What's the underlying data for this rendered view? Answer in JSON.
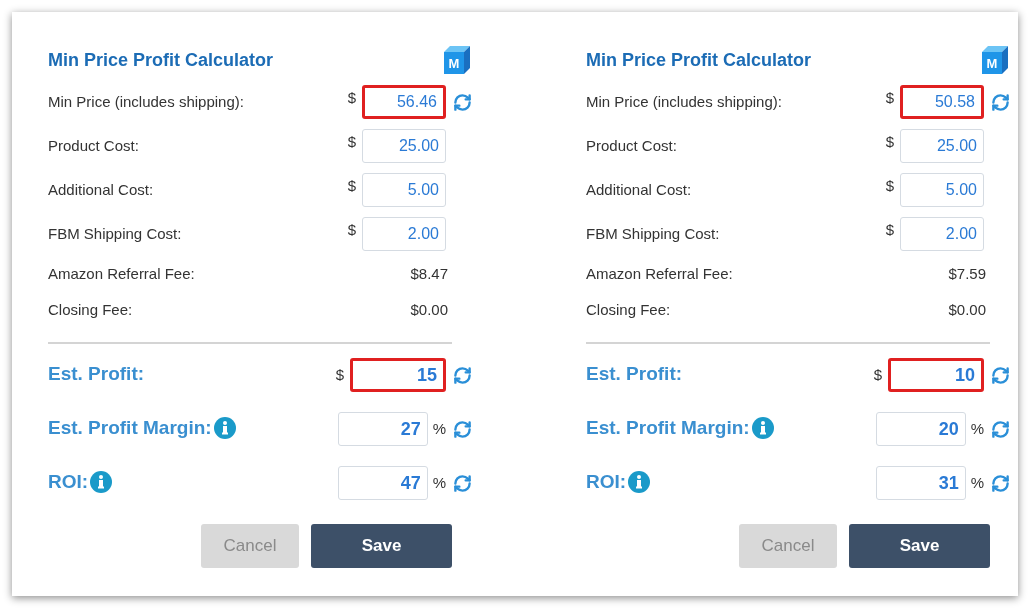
{
  "panels": [
    {
      "title": "Min Price Profit Calculator",
      "logo_letter": "M",
      "rows": [
        {
          "kind": "input",
          "label": "Min Price (includes shipping):",
          "prefix": "$",
          "value": "56.46",
          "refresh": true,
          "highlighted": true
        },
        {
          "kind": "input",
          "label": "Product Cost:",
          "prefix": "$",
          "value": "25.00",
          "refresh": false,
          "highlighted": false
        },
        {
          "kind": "input",
          "label": "Additional Cost:",
          "prefix": "$",
          "value": "5.00",
          "refresh": false,
          "highlighted": false
        },
        {
          "kind": "input",
          "label": "FBM Shipping Cost:",
          "prefix": "$",
          "value": "2.00",
          "refresh": false,
          "highlighted": false
        },
        {
          "kind": "fee",
          "label": "Amazon Referral Fee:",
          "value": "$8.47"
        },
        {
          "kind": "fee",
          "label": "Closing Fee:",
          "value": "$0.00"
        }
      ],
      "results": [
        {
          "label": "Est. Profit:",
          "info": false,
          "prefix": "$",
          "value": "15",
          "highlighted": true
        },
        {
          "label": "Est. Profit Margin:",
          "info": true,
          "suffix": "%",
          "value": "27",
          "highlighted": false
        },
        {
          "label": "ROI:",
          "info": true,
          "suffix": "%",
          "value": "47",
          "highlighted": false
        }
      ],
      "buttons": [
        {
          "label": "Cancel",
          "disabled": true
        },
        {
          "label": "Save",
          "disabled": false
        }
      ]
    },
    {
      "title": "Min Price Profit Calculator",
      "logo_letter": "M",
      "rows": [
        {
          "kind": "input",
          "label": "Min Price (includes shipping):",
          "prefix": "$",
          "value": "50.58",
          "refresh": true,
          "highlighted": true
        },
        {
          "kind": "input",
          "label": "Product Cost:",
          "prefix": "$",
          "value": "25.00",
          "refresh": false,
          "highlighted": false
        },
        {
          "kind": "input",
          "label": "Additional Cost:",
          "prefix": "$",
          "value": "5.00",
          "refresh": false,
          "highlighted": false
        },
        {
          "kind": "input",
          "label": "FBM Shipping Cost:",
          "prefix": "$",
          "value": "2.00",
          "refresh": false,
          "highlighted": false
        },
        {
          "kind": "fee",
          "label": "Amazon Referral Fee:",
          "value": "$7.59"
        },
        {
          "kind": "fee",
          "label": "Closing Fee:",
          "value": "$0.00"
        }
      ],
      "results": [
        {
          "label": "Est. Profit:",
          "info": false,
          "prefix": "$",
          "value": "10",
          "highlighted": true
        },
        {
          "label": "Est. Profit Margin:",
          "info": true,
          "suffix": "%",
          "value": "20",
          "highlighted": false
        },
        {
          "label": "ROI:",
          "info": true,
          "suffix": "%",
          "value": "31",
          "highlighted": false
        }
      ],
      "buttons": [
        {
          "label": "Cancel",
          "disabled": true
        },
        {
          "label": "Save",
          "disabled": false
        }
      ]
    }
  ]
}
